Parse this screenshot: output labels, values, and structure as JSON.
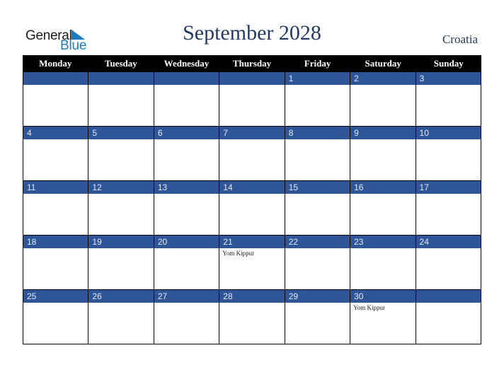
{
  "logo": {
    "line1": "General",
    "line2": "Blue"
  },
  "title": "September 2028",
  "country": "Croatia",
  "colors": {
    "header_bg": "#000000",
    "band_bg": "#2e5597",
    "title": "#253a63",
    "logo_blue": "#1c7cc0"
  },
  "weekdays": [
    "Monday",
    "Tuesday",
    "Wednesday",
    "Thursday",
    "Friday",
    "Saturday",
    "Sunday"
  ],
  "weeks": [
    [
      {
        "d": ""
      },
      {
        "d": ""
      },
      {
        "d": ""
      },
      {
        "d": ""
      },
      {
        "d": "1"
      },
      {
        "d": "2"
      },
      {
        "d": "3"
      }
    ],
    [
      {
        "d": "4"
      },
      {
        "d": "5"
      },
      {
        "d": "6"
      },
      {
        "d": "7"
      },
      {
        "d": "8"
      },
      {
        "d": "9"
      },
      {
        "d": "10"
      }
    ],
    [
      {
        "d": "11"
      },
      {
        "d": "12"
      },
      {
        "d": "13"
      },
      {
        "d": "14"
      },
      {
        "d": "15"
      },
      {
        "d": "16"
      },
      {
        "d": "17"
      }
    ],
    [
      {
        "d": "18"
      },
      {
        "d": "19"
      },
      {
        "d": "20"
      },
      {
        "d": "21",
        "e": "Yom Kippur"
      },
      {
        "d": "22"
      },
      {
        "d": "23"
      },
      {
        "d": "24"
      }
    ],
    [
      {
        "d": "25"
      },
      {
        "d": "26"
      },
      {
        "d": "27"
      },
      {
        "d": "28"
      },
      {
        "d": "29"
      },
      {
        "d": "30",
        "e": "Yom Kippur"
      },
      {
        "d": ""
      }
    ]
  ]
}
